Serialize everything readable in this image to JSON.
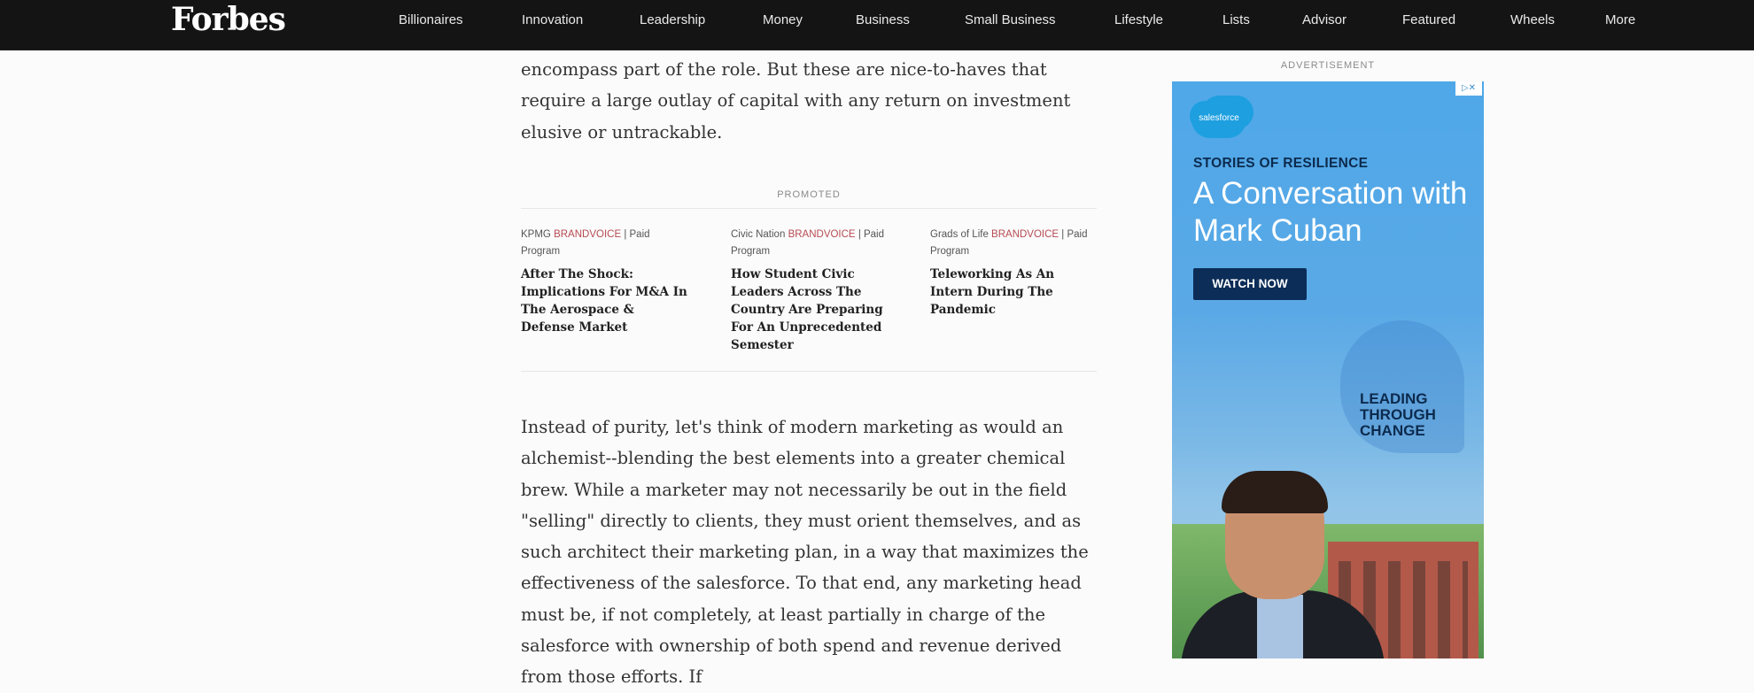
{
  "nav": {
    "logo": "Forbes",
    "items": [
      "Billionaires",
      "Innovation",
      "Leadership",
      "Money",
      "Business",
      "Small Business",
      "Lifestyle",
      "Lists",
      "Advisor",
      "Featured",
      "Wheels",
      "More"
    ]
  },
  "article": {
    "para_top": "encompass part of the role. But  these are nice-to-haves that require a large outlay of capital with any return on investment elusive or untrackable.",
    "para_bottom": "Instead of purity, let's think of modern marketing as would an alchemist--blending the best elements into a greater chemical brew. While a marketer may not necessarily be out in the field \"selling\" directly to clients, they must orient themselves, and as such architect their marketing plan, in a way that maximizes the effectiveness of the salesforce. To that end, any marketing head must be, if not completely, at least partially in charge of the salesforce with ownership of both spend and revenue derived from those efforts. If"
  },
  "promoted": {
    "label": "PROMOTED",
    "cards": [
      {
        "brand": "KPMG",
        "brandvoice": "BRANDVOICE",
        "program": "| Paid Program",
        "title": "After The Shock: Implications For M&A In The Aerospace & Defense Market"
      },
      {
        "brand": "Civic Nation",
        "brandvoice": "BRANDVOICE",
        "program": "| Paid Program",
        "title": "How Student Civic Leaders Across The Country Are Preparing For An Unprecedented Semester"
      },
      {
        "brand": "Grads of Life",
        "brandvoice": "BRANDVOICE",
        "program": "| Paid Program",
        "title": "Teleworking As An Intern During The Pandemic"
      }
    ]
  },
  "ad": {
    "label": "ADVERTISEMENT",
    "choices": "▷✕",
    "logo_text": "salesforce",
    "kicker": "STORIES OF RESILIENCE",
    "headline": "A Conversation with Mark Cuban",
    "cta": "WATCH NOW",
    "tagline": "LEADING\nTHROUGH\nCHANGE"
  }
}
